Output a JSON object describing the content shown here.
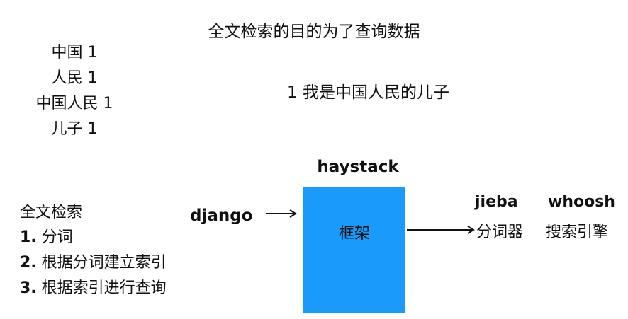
{
  "title": "全文检索的目的为了查询数据",
  "index_terms": [
    "中国 1",
    "人民 1",
    "中国人民 1",
    "儿子 1"
  ],
  "sentence": "1 我是中国人民的儿子",
  "haystack_label": "haystack",
  "django_label": "django",
  "framework_label": "框架",
  "jieba_label": "jieba",
  "whoosh_label": "whoosh",
  "tokenizer_label": "分词器",
  "search_engine_label": "搜索引擎",
  "steps": {
    "heading": "全文检索",
    "items": [
      {
        "num": "1.",
        "text": "分词"
      },
      {
        "num": "2.",
        "text": "根据分词建立索引"
      },
      {
        "num": "3.",
        "text": "根据索引进行查询"
      }
    ]
  },
  "colors": {
    "framework_box": "#1a9bfc",
    "text": "#111111"
  }
}
